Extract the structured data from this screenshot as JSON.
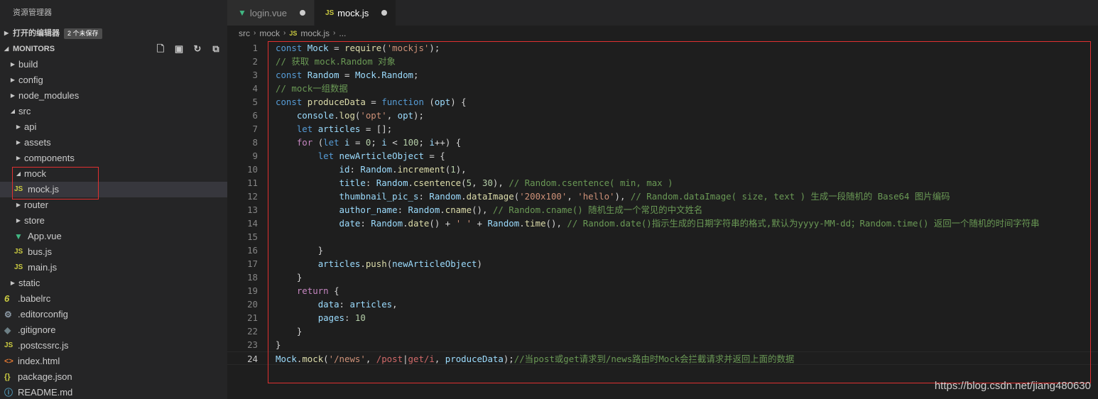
{
  "explorer": {
    "title": "资源管理器",
    "open_editors_label": "打开的编辑器",
    "unsaved_badge": "2 个未保存",
    "project_label": "MONITORS",
    "tree": [
      {
        "label": "build",
        "kind": "folder",
        "twisty": "▶"
      },
      {
        "label": "config",
        "kind": "folder",
        "twisty": "▶"
      },
      {
        "label": "node_modules",
        "kind": "folder",
        "twisty": "▶"
      },
      {
        "label": "src",
        "kind": "folder",
        "twisty": "◢"
      },
      {
        "label": "api",
        "kind": "folder",
        "twisty": "▶"
      },
      {
        "label": "assets",
        "kind": "folder",
        "twisty": "▶"
      },
      {
        "label": "components",
        "kind": "folder",
        "twisty": "▶"
      },
      {
        "label": "mock",
        "kind": "folder",
        "twisty": "◢"
      },
      {
        "label": "mock.js",
        "kind": "js",
        "icon": "JS"
      },
      {
        "label": "router",
        "kind": "folder",
        "twisty": "▶"
      },
      {
        "label": "store",
        "kind": "folder",
        "twisty": "▶"
      },
      {
        "label": "App.vue",
        "kind": "vue",
        "icon": "▼"
      },
      {
        "label": "bus.js",
        "kind": "js",
        "icon": "JS"
      },
      {
        "label": "main.js",
        "kind": "js",
        "icon": "JS"
      },
      {
        "label": "static",
        "kind": "folder",
        "twisty": "▶"
      },
      {
        "label": ".babelrc",
        "kind": "babel",
        "icon": "6"
      },
      {
        "label": ".editorconfig",
        "kind": "gear",
        "icon": "⚙"
      },
      {
        "label": ".gitignore",
        "kind": "git",
        "icon": "◆"
      },
      {
        "label": ".postcssrc.js",
        "kind": "js",
        "icon": "JS"
      },
      {
        "label": "index.html",
        "kind": "html",
        "icon": "<>"
      },
      {
        "label": "package.json",
        "kind": "json",
        "icon": "{}"
      },
      {
        "label": "README.md",
        "kind": "info",
        "icon": "ⓘ"
      }
    ]
  },
  "tabs": [
    {
      "label": "login.vue",
      "icon": "▼",
      "active": false
    },
    {
      "label": "mock.js",
      "icon": "JS",
      "active": true
    }
  ],
  "breadcrumb": {
    "parts": [
      "src",
      "mock",
      "mock.js",
      "..."
    ],
    "separator": "›",
    "file_icon": "JS"
  },
  "code": {
    "current_line": 24,
    "line_numbers": [
      "1",
      "2",
      "3",
      "4",
      "5",
      "6",
      "7",
      "8",
      "9",
      "10",
      "11",
      "12",
      "13",
      "14",
      "15",
      "16",
      "17",
      "18",
      "19",
      "20",
      "21",
      "22",
      "23",
      "24"
    ]
  },
  "watermark": "https://blog.csdn.net/jiang480630",
  "colors": {
    "keyword": "#569cd6",
    "string": "#ce9178",
    "comment": "#6a9955",
    "number": "#b5cea8",
    "highlight_box": "#e03030"
  }
}
